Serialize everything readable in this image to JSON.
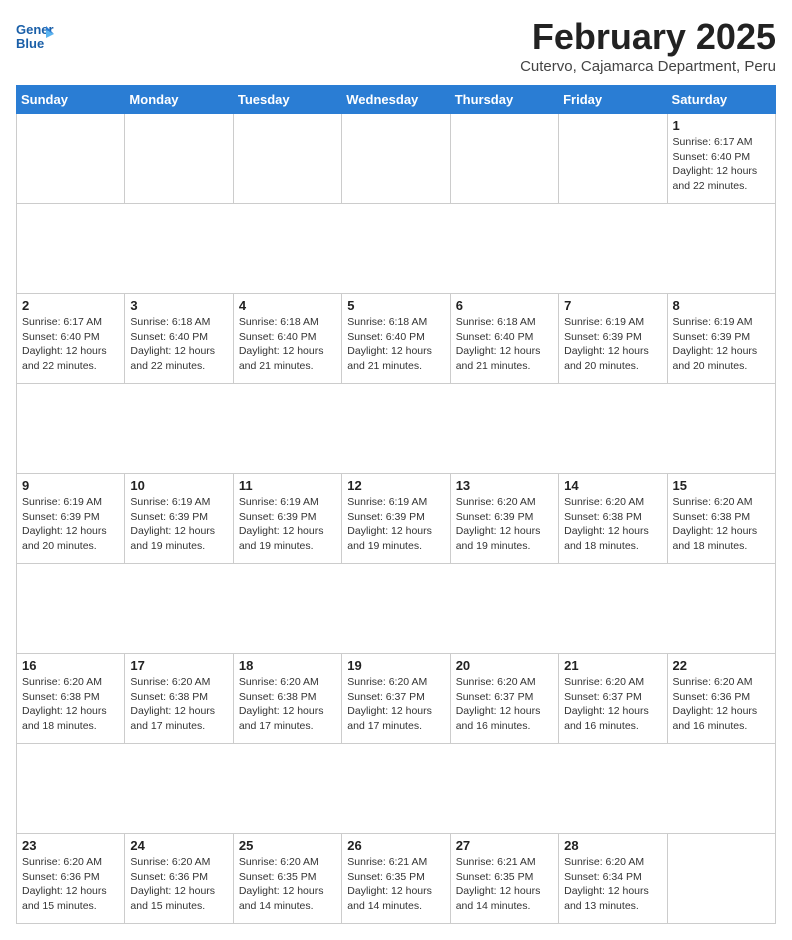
{
  "header": {
    "logo_line1": "General",
    "logo_line2": "Blue",
    "main_title": "February 2025",
    "sub_title": "Cutervo, Cajamarca Department, Peru"
  },
  "weekdays": [
    "Sunday",
    "Monday",
    "Tuesday",
    "Wednesday",
    "Thursday",
    "Friday",
    "Saturday"
  ],
  "weeks": [
    [
      {
        "day": "",
        "info": ""
      },
      {
        "day": "",
        "info": ""
      },
      {
        "day": "",
        "info": ""
      },
      {
        "day": "",
        "info": ""
      },
      {
        "day": "",
        "info": ""
      },
      {
        "day": "",
        "info": ""
      },
      {
        "day": "1",
        "info": "Sunrise: 6:17 AM\nSunset: 6:40 PM\nDaylight: 12 hours\nand 22 minutes."
      }
    ],
    [
      {
        "day": "2",
        "info": "Sunrise: 6:17 AM\nSunset: 6:40 PM\nDaylight: 12 hours\nand 22 minutes."
      },
      {
        "day": "3",
        "info": "Sunrise: 6:18 AM\nSunset: 6:40 PM\nDaylight: 12 hours\nand 22 minutes."
      },
      {
        "day": "4",
        "info": "Sunrise: 6:18 AM\nSunset: 6:40 PM\nDaylight: 12 hours\nand 21 minutes."
      },
      {
        "day": "5",
        "info": "Sunrise: 6:18 AM\nSunset: 6:40 PM\nDaylight: 12 hours\nand 21 minutes."
      },
      {
        "day": "6",
        "info": "Sunrise: 6:18 AM\nSunset: 6:40 PM\nDaylight: 12 hours\nand 21 minutes."
      },
      {
        "day": "7",
        "info": "Sunrise: 6:19 AM\nSunset: 6:39 PM\nDaylight: 12 hours\nand 20 minutes."
      },
      {
        "day": "8",
        "info": "Sunrise: 6:19 AM\nSunset: 6:39 PM\nDaylight: 12 hours\nand 20 minutes."
      }
    ],
    [
      {
        "day": "9",
        "info": "Sunrise: 6:19 AM\nSunset: 6:39 PM\nDaylight: 12 hours\nand 20 minutes."
      },
      {
        "day": "10",
        "info": "Sunrise: 6:19 AM\nSunset: 6:39 PM\nDaylight: 12 hours\nand 19 minutes."
      },
      {
        "day": "11",
        "info": "Sunrise: 6:19 AM\nSunset: 6:39 PM\nDaylight: 12 hours\nand 19 minutes."
      },
      {
        "day": "12",
        "info": "Sunrise: 6:19 AM\nSunset: 6:39 PM\nDaylight: 12 hours\nand 19 minutes."
      },
      {
        "day": "13",
        "info": "Sunrise: 6:20 AM\nSunset: 6:39 PM\nDaylight: 12 hours\nand 19 minutes."
      },
      {
        "day": "14",
        "info": "Sunrise: 6:20 AM\nSunset: 6:38 PM\nDaylight: 12 hours\nand 18 minutes."
      },
      {
        "day": "15",
        "info": "Sunrise: 6:20 AM\nSunset: 6:38 PM\nDaylight: 12 hours\nand 18 minutes."
      }
    ],
    [
      {
        "day": "16",
        "info": "Sunrise: 6:20 AM\nSunset: 6:38 PM\nDaylight: 12 hours\nand 18 minutes."
      },
      {
        "day": "17",
        "info": "Sunrise: 6:20 AM\nSunset: 6:38 PM\nDaylight: 12 hours\nand 17 minutes."
      },
      {
        "day": "18",
        "info": "Sunrise: 6:20 AM\nSunset: 6:38 PM\nDaylight: 12 hours\nand 17 minutes."
      },
      {
        "day": "19",
        "info": "Sunrise: 6:20 AM\nSunset: 6:37 PM\nDaylight: 12 hours\nand 17 minutes."
      },
      {
        "day": "20",
        "info": "Sunrise: 6:20 AM\nSunset: 6:37 PM\nDaylight: 12 hours\nand 16 minutes."
      },
      {
        "day": "21",
        "info": "Sunrise: 6:20 AM\nSunset: 6:37 PM\nDaylight: 12 hours\nand 16 minutes."
      },
      {
        "day": "22",
        "info": "Sunrise: 6:20 AM\nSunset: 6:36 PM\nDaylight: 12 hours\nand 16 minutes."
      }
    ],
    [
      {
        "day": "23",
        "info": "Sunrise: 6:20 AM\nSunset: 6:36 PM\nDaylight: 12 hours\nand 15 minutes."
      },
      {
        "day": "24",
        "info": "Sunrise: 6:20 AM\nSunset: 6:36 PM\nDaylight: 12 hours\nand 15 minutes."
      },
      {
        "day": "25",
        "info": "Sunrise: 6:20 AM\nSunset: 6:35 PM\nDaylight: 12 hours\nand 14 minutes."
      },
      {
        "day": "26",
        "info": "Sunrise: 6:21 AM\nSunset: 6:35 PM\nDaylight: 12 hours\nand 14 minutes."
      },
      {
        "day": "27",
        "info": "Sunrise: 6:21 AM\nSunset: 6:35 PM\nDaylight: 12 hours\nand 14 minutes."
      },
      {
        "day": "28",
        "info": "Sunrise: 6:20 AM\nSunset: 6:34 PM\nDaylight: 12 hours\nand 13 minutes."
      },
      {
        "day": "",
        "info": ""
      }
    ]
  ]
}
